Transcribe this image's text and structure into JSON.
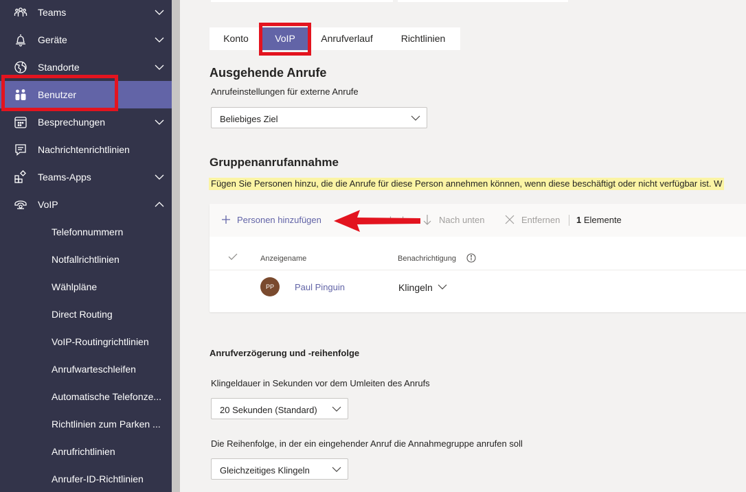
{
  "sidebar": {
    "items": [
      {
        "label": "Teams",
        "icon": "teams-icon",
        "has_chevron": true,
        "expanded": false
      },
      {
        "label": "Geräte",
        "icon": "bell-icon",
        "has_chevron": true,
        "expanded": false
      },
      {
        "label": "Standorte",
        "icon": "globe-icon",
        "has_chevron": true,
        "expanded": false
      },
      {
        "label": "Benutzer",
        "icon": "users-icon",
        "has_chevron": false,
        "active": true
      },
      {
        "label": "Besprechungen",
        "icon": "calendar-icon",
        "has_chevron": true,
        "expanded": false
      },
      {
        "label": "Nachrichtenrichtlinien",
        "icon": "message-icon",
        "has_chevron": false
      },
      {
        "label": "Teams-Apps",
        "icon": "apps-icon",
        "has_chevron": true,
        "expanded": false
      },
      {
        "label": "VoIP",
        "icon": "voip-icon",
        "has_chevron": true,
        "expanded": true
      }
    ],
    "voip_subitems": [
      "Telefonnummern",
      "Notfallrichtlinien",
      "Wählpläne",
      "Direct Routing",
      "VoIP-Routingrichtlinien",
      "Anrufwarteschleifen",
      "Automatische Telefonze...",
      "Richtlinien zum Parken ...",
      "Anrufrichtlinien",
      "Anrufer-ID-Richtlinien"
    ]
  },
  "tabs": [
    "Konto",
    "VoIP",
    "Anrufverlauf",
    "Richtlinien"
  ],
  "active_tab": "VoIP",
  "outgoing": {
    "heading": "Ausgehende Anrufe",
    "label": "Anrufeinstellungen für externe Anrufe",
    "value": "Beliebiges Ziel"
  },
  "group_pickup": {
    "heading": "Gruppenanrufannahme",
    "description": "Fügen Sie Personen hinzu, die die Anrufe für diese Person annehmen können, wenn diese beschäftigt oder nicht verfügbar ist. W",
    "toolbar": {
      "add": "Personen hinzufügen",
      "up_partial": "h ob",
      "down": "Nach unten",
      "remove": "Entfernen",
      "count_num": "1",
      "count_label": "Elemente"
    },
    "columns": {
      "name": "Anzeigename",
      "notification": "Benachrichtigung"
    },
    "rows": [
      {
        "initials": "PP",
        "name": "Paul Pinguin",
        "notification": "Klingeln"
      }
    ]
  },
  "delay": {
    "heading": "Anrufverzögerung und -reihenfolge",
    "ring_label": "Klingeldauer in Sekunden vor dem Umleiten des Anrufs",
    "ring_value": "20 Sekunden (Standard)",
    "order_label": "Die Reihenfolge, in der ein eingehender Anruf die Annahmegruppe anrufen soll",
    "order_value": "Gleichzeitiges Klingeln"
  },
  "colors": {
    "sidebar_bg": "#33344a",
    "accent": "#6264a7",
    "highlight": "#fbf4a4",
    "annotation_red": "#e3141f"
  }
}
